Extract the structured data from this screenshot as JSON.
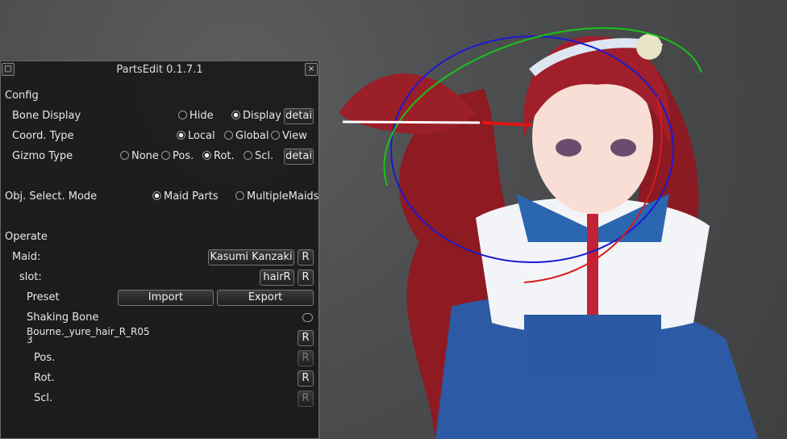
{
  "window": {
    "title": "PartsEdit 0.1.7.1",
    "min_icon": "□",
    "close_icon": "×"
  },
  "config": {
    "header": "Config",
    "bone_display": {
      "label": "Bone Display",
      "options": [
        "Hide",
        "Display"
      ],
      "selected": "Display",
      "button": "detai"
    },
    "coord_type": {
      "label": "Coord. Type",
      "options": [
        "Local",
        "Global",
        "View"
      ],
      "selected": "Local"
    },
    "gizmo_type": {
      "label": "Gizmo Type",
      "options": [
        "None",
        "Pos.",
        "Rot.",
        "Scl."
      ],
      "selected": "Rot.",
      "button": "detai"
    },
    "obj_select": {
      "label": "Obj. Select. Mode",
      "options": [
        "Maid Parts",
        "MultipleMaids"
      ],
      "selected": "Maid Parts"
    }
  },
  "operate": {
    "header": "Operate",
    "maid_label": "Maid:",
    "maid_value": "Kasumi Kanzaki",
    "reset": "R",
    "slot_label": "slot:",
    "slot_value": "hairR",
    "preset_label": "Preset",
    "import": "Import",
    "export": "Export",
    "shaking_bone": "Shaking Bone",
    "bone_name": "Bourne._yure_hair_R_R05",
    "bone_name_line2": "3",
    "pos": "Pos.",
    "rot": "Rot.",
    "scl": "Scl."
  }
}
